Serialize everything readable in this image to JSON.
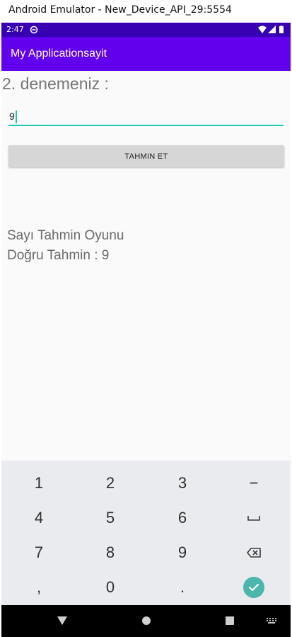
{
  "window": {
    "title": "Android Emulator - New_Device_API_29:5554"
  },
  "statusbar": {
    "time": "2:47",
    "notification_icon": "sync-icon",
    "status_icons": [
      "wifi-icon",
      "signal-icon",
      "battery-icon"
    ]
  },
  "appbar": {
    "title": "My Applicationsayit"
  },
  "main": {
    "attempt_label": "2. denemeniz :",
    "guess_input_value": "9",
    "guess_button_label": "TAHMIN ET",
    "game_title": "Sayı Tahmin Oyunu",
    "result_text": "Doğru Tahmin : 9"
  },
  "keyboard": {
    "rows": [
      [
        "1",
        "2",
        "3",
        "−"
      ],
      [
        "4",
        "5",
        "6",
        "space-icon"
      ],
      [
        "7",
        "8",
        "9",
        "backspace-icon"
      ],
      [
        ",",
        "0",
        ".",
        "done-check-icon"
      ]
    ]
  },
  "navbar": {
    "buttons": [
      "back-icon",
      "home-icon",
      "recents-icon",
      "keyboard-switch-icon"
    ]
  },
  "colors": {
    "status_bar": "#3700b3",
    "app_bar": "#6200ee",
    "accent": "#1ec8b5",
    "button": "#d6d6d6",
    "keyboard_enter": "#4db6ac"
  }
}
